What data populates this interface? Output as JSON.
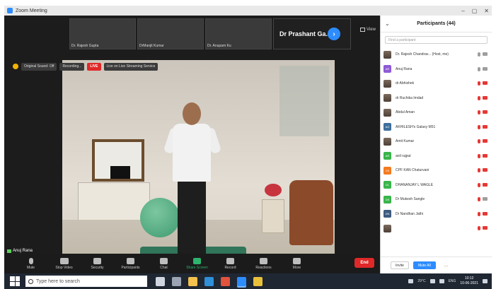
{
  "window": {
    "title": "Zoom Meeting",
    "controls": [
      "–",
      "▢",
      "✕"
    ]
  },
  "thumbnails": [
    {
      "name": "Dr. Rajesh Gupta"
    },
    {
      "name": "DrManjit Kumar"
    },
    {
      "name": "Dr. Anupam Ku"
    },
    {
      "name": "Dr Prashant Ga..."
    }
  ],
  "view_label": "View",
  "info_bar": {
    "original_sound": "Original Sound: Off",
    "recording": "Recording...",
    "live": "LIVE",
    "live_on": "Live on Live Streaming Service"
  },
  "speaker_label": "Anuj Rana",
  "toolbar": {
    "items": [
      {
        "label": "Mute",
        "icon": "mic-icon"
      },
      {
        "label": "Stop Video",
        "icon": "camera-icon"
      },
      {
        "label": "Security",
        "icon": "shield-icon"
      },
      {
        "label": "Participants",
        "icon": "people-icon",
        "count": "44"
      },
      {
        "label": "Chat",
        "icon": "chat-icon"
      },
      {
        "label": "Share Screen",
        "icon": "share-screen-icon"
      },
      {
        "label": "Record",
        "icon": "record-icon"
      },
      {
        "label": "Reactions",
        "icon": "reactions-icon"
      },
      {
        "label": "More",
        "icon": "more-icon"
      }
    ],
    "end_label": "End"
  },
  "participants": {
    "title": "Participants (44)",
    "search_placeholder": "Find a participant",
    "list": [
      {
        "name": "Dr. Rajesh Chandrav... (Host, me)",
        "initials": "",
        "color": "#8a6f5e",
        "mic": "grey",
        "cam": "grey"
      },
      {
        "name": "Anuj Rana",
        "initials": "AR",
        "color": "#8e5bd6",
        "mic": "grey",
        "cam": "grey"
      },
      {
        "name": "dr Abhishek",
        "initials": "",
        "color": "#7a6a5a",
        "mic": "red",
        "cam": "red"
      },
      {
        "name": "dr Ruchika Imdad",
        "initials": "",
        "color": "#5c5c5c",
        "mic": "red",
        "cam": "red"
      },
      {
        "name": "Abdul Aman",
        "initials": "",
        "color": "#4a4a4a",
        "mic": "red",
        "cam": "red"
      },
      {
        "name": "AKHILESH's Galaxy M51",
        "initials": "AG",
        "color": "#3f6f9c",
        "mic": "red",
        "cam": "red"
      },
      {
        "name": "Amit Kumar",
        "initials": "",
        "color": "#8f7862",
        "mic": "red",
        "cam": "red"
      },
      {
        "name": "anil rajput",
        "initials": "AR",
        "color": "#39b54a",
        "mic": "red",
        "cam": "red"
      },
      {
        "name": "CPF KAN Chaturvani",
        "initials": "CK",
        "color": "#f47a20",
        "mic": "red",
        "cam": "red"
      },
      {
        "name": "DHANANJAY L WAGLE",
        "initials": "DL",
        "color": "#39b54a",
        "mic": "red",
        "cam": "red"
      },
      {
        "name": "Dr Mukesh Sangle",
        "initials": "DS",
        "color": "#39b54a",
        "mic": "red",
        "cam": "grey"
      },
      {
        "name": "Dr Nandhan Jathi",
        "initials": "DN",
        "color": "#3d5a80",
        "mic": "red",
        "cam": "red"
      },
      {
        "name": "",
        "initials": "",
        "color": "#f47a20",
        "mic": "red",
        "cam": "red"
      }
    ],
    "invite_label": "Invite",
    "mute_all_label": "Mute All",
    "more_label": "..."
  },
  "taskbar": {
    "search_placeholder": "Type here to search",
    "temperature": "29°C",
    "language": "ENG",
    "time": "10:12",
    "date": "10-06-2021"
  }
}
